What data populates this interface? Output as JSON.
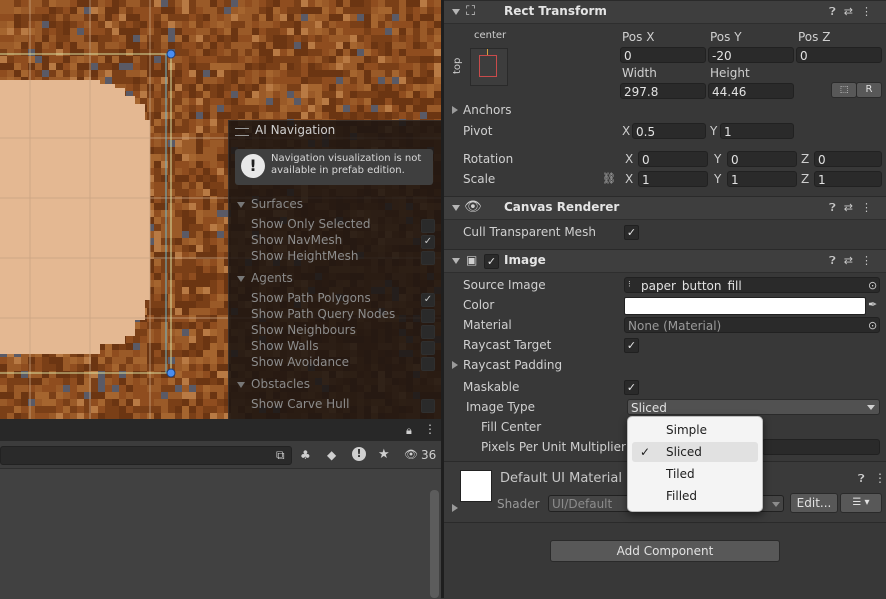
{
  "colors": {
    "dirt": "#8a4a1e",
    "panel_fill": "#e4b892",
    "selection": "#4a8df0"
  },
  "ai_navigation": {
    "title": "AI Navigation",
    "note": "Navigation visualization is not available in prefab edition.",
    "sections": [
      {
        "name": "Surfaces",
        "items": [
          {
            "label": "Show Only Selected",
            "checked": false
          },
          {
            "label": "Show NavMesh",
            "checked": true
          },
          {
            "label": "Show HeightMesh",
            "checked": false
          }
        ]
      },
      {
        "name": "Agents",
        "items": [
          {
            "label": "Show Path Polygons",
            "checked": true
          },
          {
            "label": "Show Path Query Nodes",
            "checked": false
          },
          {
            "label": "Show Neighbours",
            "checked": false
          },
          {
            "label": "Show Walls",
            "checked": false
          },
          {
            "label": "Show Avoidance",
            "checked": false
          }
        ]
      },
      {
        "name": "Obstacles",
        "items": [
          {
            "label": "Show Carve Hull",
            "checked": false
          }
        ]
      }
    ]
  },
  "left_toolbar": {
    "lock_icon": "lock-icon",
    "visible_count": "36"
  },
  "rect_transform": {
    "title": "Rect Transform",
    "anchor_h": "center",
    "anchor_v": "top",
    "pos_x_label": "Pos X",
    "pos_y_label": "Pos Y",
    "pos_z_label": "Pos Z",
    "pos_x": "0",
    "pos_y": "-20",
    "pos_z": "0",
    "width_label": "Width",
    "height_label": "Height",
    "width": "297.8",
    "height": "44.46",
    "r_button": "R",
    "anchors_label": "Anchors",
    "pivot_label": "Pivot",
    "pivot_x": "0.5",
    "pivot_y": "1",
    "rotation_label": "Rotation",
    "rot_x": "0",
    "rot_y": "0",
    "rot_z": "0",
    "scale_label": "Scale",
    "scale_x": "1",
    "scale_y": "1",
    "scale_z": "1",
    "x": "X",
    "y": "Y",
    "z": "Z"
  },
  "canvas_renderer": {
    "title": "Canvas Renderer",
    "cull_label": "Cull Transparent Mesh",
    "cull_checked": true
  },
  "image": {
    "title": "Image",
    "enabled": true,
    "source_image_label": "Source Image",
    "source_image": "paper_button_fill",
    "color_label": "Color",
    "color_value": "#ffffff",
    "material_label": "Material",
    "material": "None (Material)",
    "raycast_target_label": "Raycast Target",
    "raycast_target": true,
    "raycast_padding_label": "Raycast Padding",
    "maskable_label": "Maskable",
    "maskable": true,
    "image_type_label": "Image Type",
    "image_type": "Sliced",
    "fill_center_label": "Fill Center",
    "ppu_label": "Pixels Per Unit Multiplier"
  },
  "image_type_popup": {
    "options": [
      "Simple",
      "Sliced",
      "Tiled",
      "Filled"
    ],
    "selected": "Sliced",
    "check_mark": "✓"
  },
  "material_preview": {
    "name_visible": "Default UI Material (M",
    "shader_label": "Shader",
    "shader": "UI/Default",
    "edit_button": "Edit..."
  },
  "add_component": "Add Component"
}
